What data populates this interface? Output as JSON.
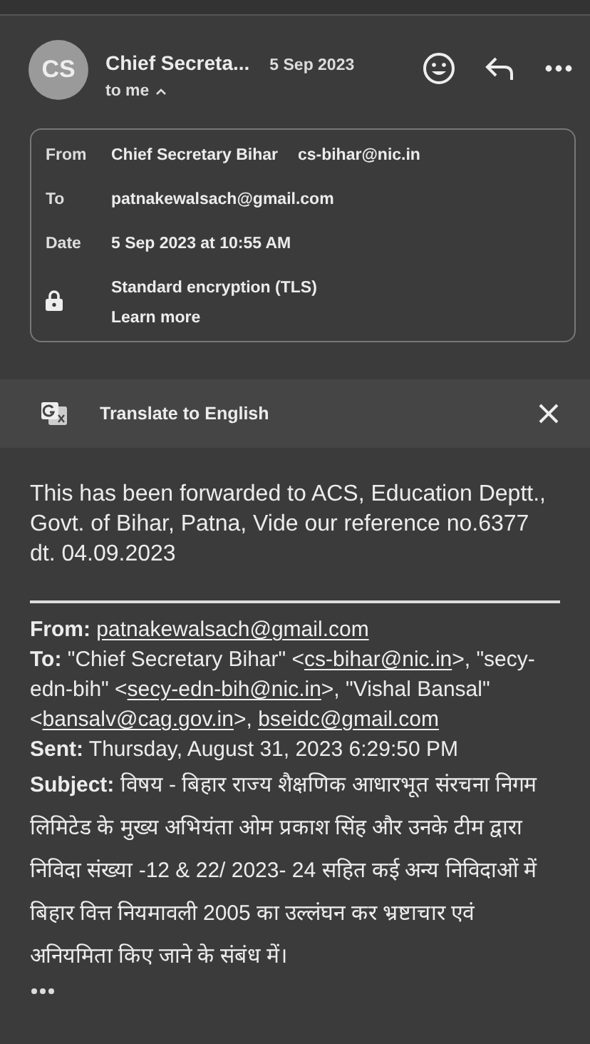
{
  "header": {
    "avatar_initials": "CS",
    "sender": "Chief Secreta...",
    "date": "5 Sep 2023",
    "recipient": "to me",
    "expanded": true
  },
  "details": {
    "rows": [
      {
        "label": "From",
        "value": "Chief Secretary  Bihar",
        "extra": "cs-bihar@nic.in"
      },
      {
        "label": "To",
        "value": "patnakewalsach@gmail.com"
      },
      {
        "label": "Date",
        "value": "5 Sep 2023 at 10:55 AM"
      }
    ],
    "security": {
      "title": "Standard encryption (TLS)",
      "link": "Learn more"
    }
  },
  "translate_bar": {
    "label": "Translate to English"
  },
  "body": {
    "paragraphs": [
      "This has been forwarded to ACS, Education Deptt.,",
      "Govt. of Bihar, Patna, Vide our reference no.6377 dt. 04.09.2023"
    ]
  },
  "forwarded": [
    {
      "label": "From:",
      "parts": [
        {
          "text": "patnakewalsach@gmail.com",
          "link": true
        }
      ]
    },
    {
      "label": "To:",
      "parts": [
        {
          "text": "\"Chief Secretary Bihar\" <",
          "link": false
        },
        {
          "text": "cs-bihar@nic.in",
          "link": true
        },
        {
          "text": ">, \"secy-edn-bih\" <",
          "link": false
        },
        {
          "text": "secy-edn-bih@nic.in",
          "link": true
        },
        {
          "text": ">, \"Vishal Bansal\" <",
          "link": false
        },
        {
          "text": "bansalv@cag.gov.in",
          "link": true
        },
        {
          "text": ">, ",
          "link": false
        },
        {
          "text": "bseidc@gmail.com",
          "link": true
        }
      ]
    },
    {
      "label": "Sent:",
      "parts": [
        {
          "text": "Thursday, August 31, 2023 6:29:50 PM",
          "link": false
        }
      ]
    },
    {
      "label": "Subject:",
      "parts": [
        {
          "text": "विषय - बिहार राज्य शैक्षणिक आधारभूत संरचना निगम लिमिटेड के मुख्य अभियंता ओम प्रकाश सिंह और उनके टीम द्वारा निविदा संख्या -12 & 22/ 2023- 24 सहित कई अन्य निविदाओं में बिहार वित्त नियमावली 2005 का उल्लंघन कर भ्रष्टाचार एवं अनियमिता किए जाने के संबंध में।",
          "link": false
        }
      ]
    }
  ]
}
